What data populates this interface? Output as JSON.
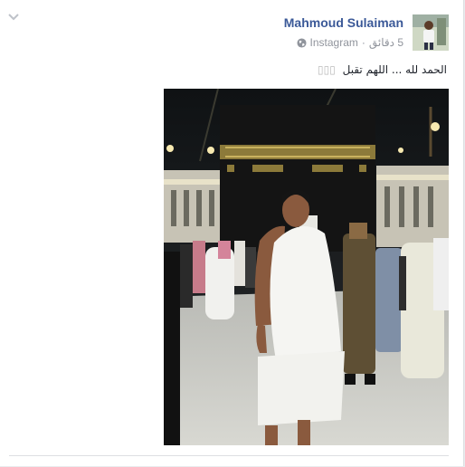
{
  "post": {
    "author": "Mahmoud Sulaiman",
    "time": "5 دقائق",
    "separator": "·",
    "source": "Instagram",
    "text": "الحمد لله ... اللهم تقبل",
    "emoji_boxes": "▯▯▯"
  },
  "icons": {
    "menu": "chevron-down-icon",
    "privacy": "globe-icon"
  },
  "colors": {
    "author_link": "#3b5998",
    "meta_text": "#90949c",
    "body_text": "#1d2129",
    "background": "#e9ebee"
  }
}
